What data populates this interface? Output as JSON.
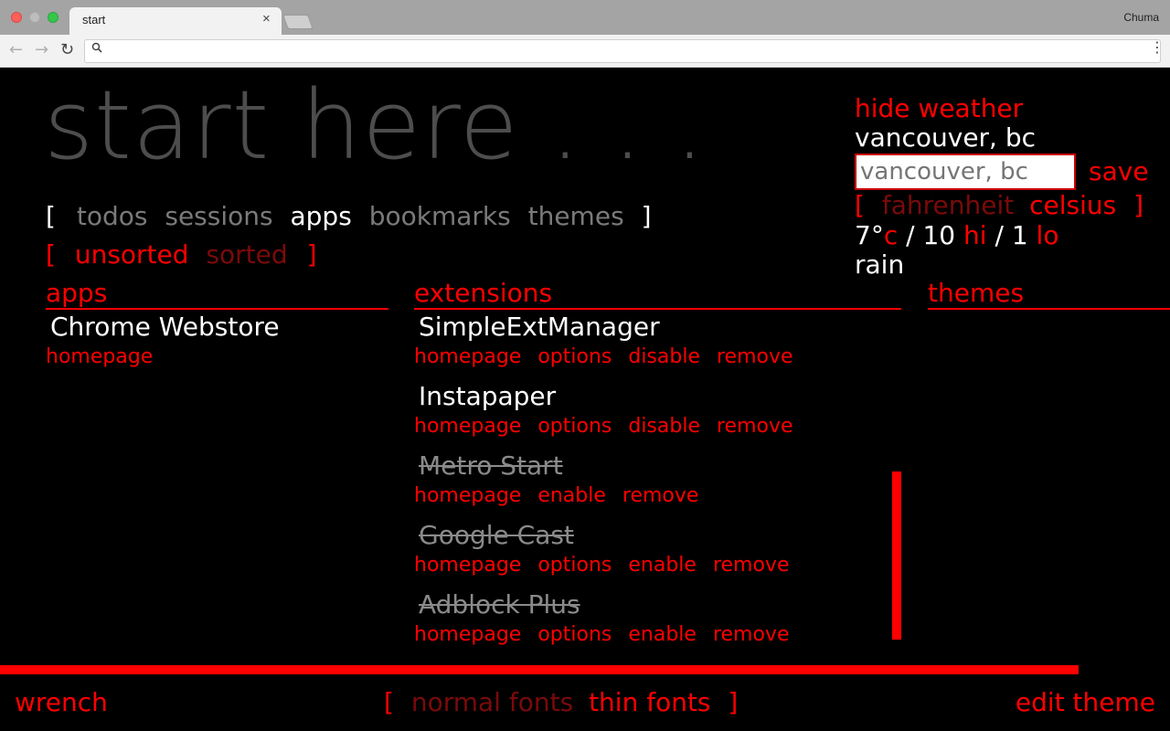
{
  "browser": {
    "tab_title": "start",
    "tab_close": "×",
    "user_name": "Chuma",
    "nav_back": "←",
    "nav_forward": "→",
    "nav_reload": "↻",
    "menu": "⋮",
    "address": ""
  },
  "page": {
    "title": "start here . . .",
    "nav": {
      "open": "[",
      "items": [
        "todos",
        "sessions",
        "apps",
        "bookmarks",
        "themes"
      ],
      "close": "]",
      "active": "apps"
    },
    "sort": {
      "open": "[",
      "unsorted": "unsorted",
      "sorted": "sorted",
      "close": "]"
    },
    "sections": {
      "apps": "apps",
      "extensions": "extensions",
      "themes": "themes"
    },
    "apps": [
      {
        "name": "Chrome Webstore",
        "links": [
          "homepage"
        ]
      }
    ],
    "extensions": [
      {
        "name": "SimpleExtManager",
        "disabled": false,
        "links": [
          "homepage",
          "options",
          "disable",
          "remove"
        ]
      },
      {
        "name": "Instapaper",
        "disabled": false,
        "links": [
          "homepage",
          "options",
          "disable",
          "remove"
        ]
      },
      {
        "name": "Metro Start",
        "disabled": true,
        "links": [
          "homepage",
          "enable",
          "remove"
        ]
      },
      {
        "name": "Google Cast",
        "disabled": true,
        "links": [
          "homepage",
          "options",
          "enable",
          "remove"
        ]
      },
      {
        "name": "Adblock Plus",
        "disabled": true,
        "links": [
          "homepage",
          "options",
          "enable",
          "remove"
        ]
      }
    ],
    "weather": {
      "hide": "hide weather",
      "city": "vancouver, bc",
      "input_placeholder": "vancouver, bc",
      "save": "save",
      "unit_open": "[",
      "fahrenheit": "fahrenheit",
      "celsius": "celsius",
      "unit_close": "]",
      "temp": "7°",
      "temp_unit": "c",
      "sep1": "/",
      "hi_value": "10",
      "hi_label": "hi",
      "sep2": "/",
      "lo_value": "1",
      "lo_label": "lo",
      "condition": "rain"
    },
    "footer": {
      "wrench": "wrench",
      "font_open": "[",
      "normal_fonts": "normal fonts",
      "thin_fonts": "thin fonts",
      "font_close": "]",
      "edit_theme": "edit theme"
    },
    "colors": {
      "accent": "#ff0000",
      "background": "#000000",
      "title": "#4d4d4d",
      "muted": "#7a7a7a"
    }
  }
}
